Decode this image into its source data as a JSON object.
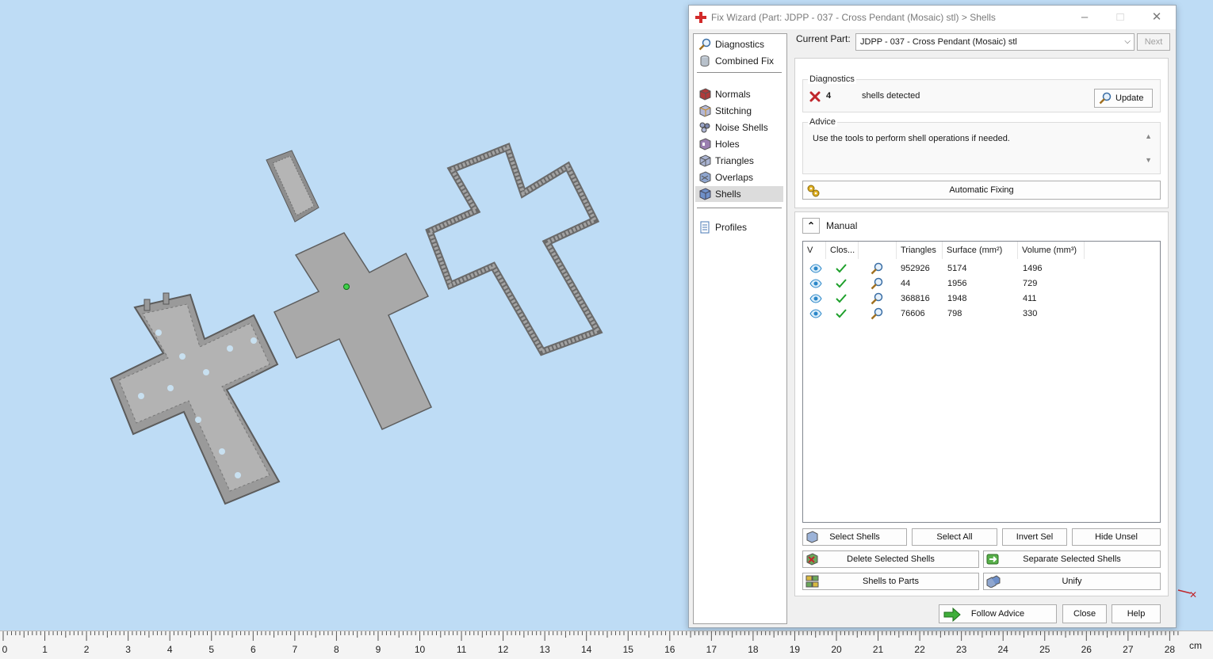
{
  "window": {
    "title": "Fix Wizard (Part: JDPP - 037 - Cross Pendant (Mosaic) stl) > Shells",
    "minimize": "–",
    "maximize": "□",
    "close": "✕"
  },
  "nav": {
    "top": [
      {
        "label": "Diagnostics",
        "icon": "magnifier-icon"
      },
      {
        "label": "Combined Fix",
        "icon": "cylinder-icon"
      }
    ],
    "tools": [
      {
        "label": "Normals",
        "icon": "normals-icon"
      },
      {
        "label": "Stitching",
        "icon": "stitching-icon"
      },
      {
        "label": "Noise Shells",
        "icon": "noise-shells-icon"
      },
      {
        "label": "Holes",
        "icon": "holes-icon"
      },
      {
        "label": "Triangles",
        "icon": "triangles-icon"
      },
      {
        "label": "Overlaps",
        "icon": "overlaps-icon"
      },
      {
        "label": "Shells",
        "icon": "shells-icon",
        "selected": true
      }
    ],
    "bottom": [
      {
        "label": "Profiles",
        "icon": "profiles-icon"
      }
    ]
  },
  "current_part": {
    "label": "Current Part:",
    "value": "JDPP - 037 - Cross Pendant (Mosaic) stl",
    "next_label": "Next"
  },
  "diagnostics": {
    "header": "Diagnostics",
    "count": "4",
    "text": "shells detected",
    "status_icon": "error-x-icon",
    "update_label": "Update"
  },
  "advice": {
    "header": "Advice",
    "text": "Use the tools to perform shell operations if needed."
  },
  "automatic_fixing_label": "Automatic Fixing",
  "manual": {
    "label": "Manual",
    "columns": [
      "V",
      "Clos...",
      "",
      "Triangles",
      "Surface (mm²)",
      "Volume (mm³)"
    ],
    "rows": [
      {
        "triangles": "952926",
        "surface": "5174",
        "volume": "1496"
      },
      {
        "triangles": "44",
        "surface": "1956",
        "volume": "729"
      },
      {
        "triangles": "368816",
        "surface": "1948",
        "volume": "411"
      },
      {
        "triangles": "76606",
        "surface": "798",
        "volume": "330"
      }
    ]
  },
  "buttons": {
    "select_shells": "Select Shells",
    "select_all": "Select All",
    "invert_sel": "Invert Sel",
    "hide_unsel": "Hide Unsel",
    "delete_selected": "Delete Selected Shells",
    "separate_selected": "Separate Selected Shells",
    "shells_to_parts": "Shells to Parts",
    "unify": "Unify",
    "follow_advice": "Follow Advice",
    "close": "Close",
    "help": "Help"
  },
  "ruler": {
    "labels": [
      "0",
      "1",
      "2",
      "3",
      "4",
      "5",
      "6",
      "7",
      "8",
      "9",
      "10",
      "11",
      "12",
      "13",
      "14",
      "15",
      "16",
      "17",
      "18",
      "19",
      "20",
      "21",
      "22",
      "23",
      "24",
      "25",
      "26",
      "27",
      "28"
    ],
    "unit": "cm"
  },
  "colors": {
    "viewport_bg": "#bedcf5",
    "model_gray": "#a7a7a7",
    "check_green": "#1fa02c",
    "error_red": "#c0262c",
    "eye_blue": "#2a86c8"
  }
}
